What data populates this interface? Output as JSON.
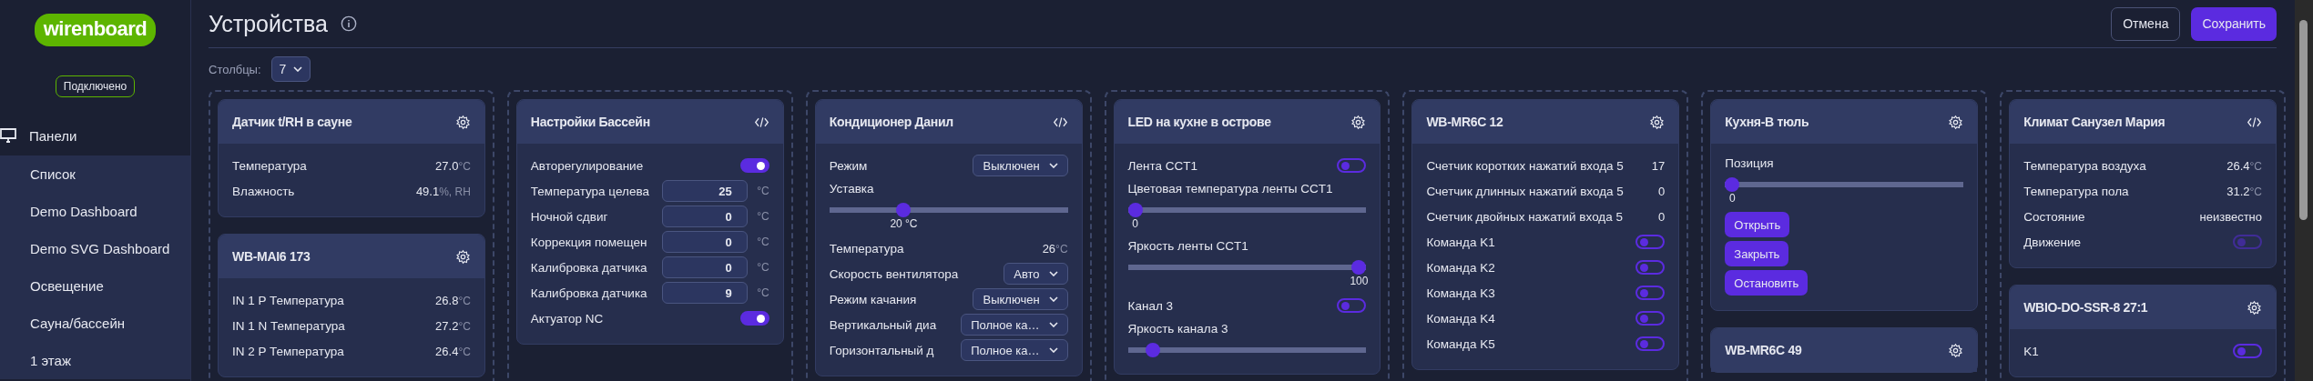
{
  "sidebar": {
    "logo": "wirenboard",
    "status": "Подключено",
    "nav": [
      {
        "label": "Панели",
        "expanded": true,
        "children": [
          {
            "label": "Список"
          },
          {
            "label": "Demo Dashboard"
          },
          {
            "label": "Demo SVG Dashboard"
          },
          {
            "label": "Освещение"
          },
          {
            "label": "Сауна/бассейн"
          },
          {
            "label": "1 этаж"
          }
        ]
      }
    ]
  },
  "header": {
    "title": "Устройства",
    "buttons": [
      {
        "label": "Отмена",
        "kind": "secondary"
      },
      {
        "label": "Сохранить",
        "kind": "primary"
      }
    ]
  },
  "toolbar": {
    "label": "Столбцы:",
    "value": "7"
  },
  "columns": [
    {
      "cards": [
        {
          "title": "Датчик t/RH в сауне",
          "kind": "device",
          "rows": [
            {
              "kind": "value",
              "label": "Температура",
              "value": "27.0",
              "unit": "°C"
            },
            {
              "kind": "value",
              "label": "Влажность",
              "value": "49.1",
              "unit": "%, RH"
            }
          ]
        },
        {
          "title": "WB-MAI6 173",
          "kind": "device",
          "rows": [
            {
              "kind": "value",
              "label": "IN 1 P Температура",
              "value": "26.8",
              "unit": "°C"
            },
            {
              "kind": "value",
              "label": "IN 1 N Температура",
              "value": "27.2",
              "unit": "°C"
            },
            {
              "kind": "value",
              "label": "IN 2 P Температура",
              "value": "26.4",
              "unit": "°C"
            }
          ]
        }
      ]
    },
    {
      "cards": [
        {
          "title": "Настройки Бассейн",
          "kind": "script",
          "rows": [
            {
              "kind": "switch",
              "label": "Авторегулирование",
              "on": true,
              "disabled": false
            },
            {
              "kind": "input",
              "label": "Температура целева",
              "value": "25",
              "unit": "°C"
            },
            {
              "kind": "input",
              "label": "Ночной сдвиг",
              "value": "0",
              "unit": "°C"
            },
            {
              "kind": "input",
              "label": "Коррекция помещен",
              "value": "0",
              "unit": "°C"
            },
            {
              "kind": "input",
              "label": "Калибровка датчика",
              "value": "0",
              "unit": "°C"
            },
            {
              "kind": "input",
              "label": "Калибровка датчика",
              "value": "9",
              "unit": "°C"
            },
            {
              "kind": "switch",
              "label": "Актуатор NC",
              "on": true,
              "disabled": false
            }
          ]
        }
      ]
    },
    {
      "cards": [
        {
          "title": "Кондиционер Данил",
          "kind": "script",
          "rows": [
            {
              "kind": "select",
              "label": "Режим",
              "value": "Выключен"
            },
            {
              "kind": "slider",
              "label": "Уставка",
              "level": 0.3,
              "reading": "20 °C"
            },
            {
              "kind": "value",
              "label": "Температура",
              "value": "26",
              "unit": "°C"
            },
            {
              "kind": "select",
              "label": "Скорость вентилятора",
              "value": "Авто"
            },
            {
              "kind": "select",
              "label": "Режим качания",
              "value": "Выключен"
            },
            {
              "kind": "select",
              "label": "Вертикальный диа",
              "value": "Полное ка…"
            },
            {
              "kind": "select",
              "label": "Горизонтальный д",
              "value": "Полное ка…"
            }
          ]
        }
      ]
    },
    {
      "cards": [
        {
          "title": "LED на кухне в острове",
          "kind": "device",
          "rows": [
            {
              "kind": "switch",
              "label": "Лента CCT1",
              "on": false,
              "disabled": false
            },
            {
              "kind": "slider",
              "label": "Цветовая температура ленты CCT1",
              "level": 0,
              "reading": "0"
            },
            {
              "kind": "slider",
              "label": "Яркость ленты CCT1",
              "level": 1,
              "reading": "100"
            },
            {
              "kind": "switch",
              "label": "Канал 3",
              "on": false,
              "disabled": false
            },
            {
              "kind": "slider",
              "label": "Яркость канала 3",
              "level": 0.08
            }
          ]
        }
      ]
    },
    {
      "cards": [
        {
          "title": "WB-MR6C 12",
          "kind": "device",
          "rows": [
            {
              "kind": "value",
              "label": "Счетчик коротких нажатий входа 5",
              "value": "17"
            },
            {
              "kind": "value",
              "label": "Счетчик длинных нажатий входа 5",
              "value": "0"
            },
            {
              "kind": "value",
              "label": "Счетчик двойных нажатий входа 5",
              "value": "0"
            },
            {
              "kind": "switch",
              "label": "Команда K1",
              "on": false,
              "disabled": false
            },
            {
              "kind": "switch",
              "label": "Команда K2",
              "on": false,
              "disabled": false
            },
            {
              "kind": "switch",
              "label": "Команда K3",
              "on": false,
              "disabled": false
            },
            {
              "kind": "switch",
              "label": "Команда K4",
              "on": false,
              "disabled": false
            },
            {
              "kind": "switch",
              "label": "Команда K5",
              "on": false,
              "disabled": false
            }
          ]
        }
      ]
    },
    {
      "cards": [
        {
          "title": "Кухня-В тюль",
          "kind": "device",
          "rows": [
            {
              "kind": "slider",
              "label": "Позиция",
              "level": 0,
              "reading": "0"
            },
            {
              "kind": "button",
              "label": "Открыть"
            },
            {
              "kind": "button",
              "label": "Закрыть"
            },
            {
              "kind": "button",
              "label": "Остановить"
            }
          ]
        },
        {
          "title": "WB-MR6C 49",
          "kind": "device"
        }
      ]
    },
    {
      "cards": [
        {
          "title": "Климат Санузел Мария",
          "kind": "script",
          "rows": [
            {
              "kind": "value",
              "label": "Температура воздуха",
              "value": "26.4",
              "unit": "°C"
            },
            {
              "kind": "value",
              "label": "Температура пола",
              "value": "31.2",
              "unit": "°C"
            },
            {
              "kind": "value",
              "label": "Состояние",
              "value": "неизвестно"
            },
            {
              "kind": "switch",
              "label": "Движение",
              "on": false,
              "disabled": true
            }
          ]
        },
        {
          "title": "WBIO-DO-SSR-8 27:1",
          "kind": "device",
          "rows": [
            {
              "kind": "switch",
              "label": "K1",
              "on": false,
              "disabled": false
            }
          ]
        }
      ]
    }
  ]
}
